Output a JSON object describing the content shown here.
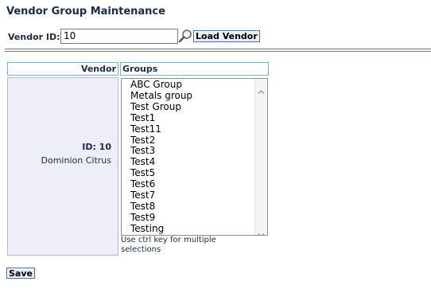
{
  "page": {
    "title": "Vendor Group Maintenance"
  },
  "search": {
    "label": "Vendor ID:",
    "value": "10",
    "load_button": "Load Vendor"
  },
  "table": {
    "headers": {
      "vendor": "Vendor",
      "groups": "Groups"
    },
    "vendor": {
      "id_text": "ID: 10",
      "name": "Dominion Citrus"
    },
    "groups": [
      "ABC Group",
      "Metals group",
      "Test Group",
      "Test1",
      "Test11",
      "Test2",
      "Test3",
      "Test4",
      "Test5",
      "Test6",
      "Test7",
      "Test8",
      "Test9",
      "Testing"
    ],
    "hint": "Use ctrl key for multiple selections"
  },
  "actions": {
    "save_label": "Save"
  },
  "icons": {
    "search": "magnifier-icon",
    "scroll_up": "chevron-up-icon",
    "scroll_down": "chevron-down-icon"
  },
  "colors": {
    "header_border": "#6fb6d9",
    "vendor_cell_bg": "#eeeefa",
    "button_bg": "#e8eefa",
    "text": "#1b2a4a"
  }
}
